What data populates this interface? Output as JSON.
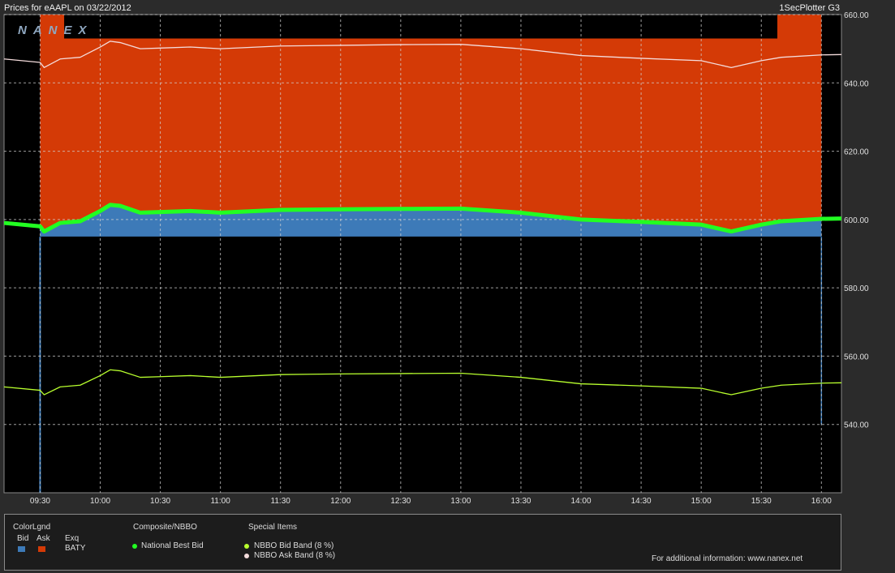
{
  "header": {
    "title": "Prices for  eAAPL  on  03/22/2012",
    "product": "1SecPlotter G3",
    "watermark": "NANEX"
  },
  "colors": {
    "bid": "#3d7ab8",
    "ask": "#d43a06",
    "nbb": "#22ff22",
    "bid_band": "#b8ff2e",
    "ask_band": "#f4dcdc"
  },
  "chart_data": {
    "type": "line",
    "title": "Prices for  eAAPL  on  03/22/2012",
    "xlabel": "",
    "ylabel": "",
    "x_ticks": [
      "09:30",
      "10:00",
      "10:30",
      "11:00",
      "11:30",
      "12:00",
      "12:30",
      "13:00",
      "13:30",
      "14:00",
      "14:30",
      "15:00",
      "15:30",
      "16:00"
    ],
    "y_ticks": [
      "540.00",
      "560.00",
      "580.00",
      "600.00",
      "620.00",
      "640.00",
      "660.00"
    ],
    "xlim": [
      "09:12",
      "16:10"
    ],
    "ylim": [
      520,
      660
    ],
    "grid": true,
    "series": [
      {
        "name": "National Best Bid",
        "color": "#22ff22",
        "x": [
          "09:12",
          "09:30",
          "09:32",
          "09:40",
          "09:50",
          "10:00",
          "10:05",
          "10:10",
          "10:20",
          "10:30",
          "10:45",
          "11:00",
          "11:30",
          "12:00",
          "12:30",
          "13:00",
          "13:30",
          "14:00",
          "14:30",
          "15:00",
          "15:15",
          "15:30",
          "15:40",
          "16:00",
          "16:10"
        ],
        "values": [
          599.0,
          598.0,
          596.5,
          599.0,
          599.5,
          602.5,
          604.3,
          604.0,
          602.0,
          602.2,
          602.5,
          602.0,
          602.8,
          603.0,
          603.1,
          603.2,
          602.0,
          600.0,
          599.3,
          598.5,
          596.5,
          598.5,
          599.5,
          600.2,
          600.3
        ]
      },
      {
        "name": "NBBO Bid Band (8 %)",
        "color": "#b8ff2e",
        "x": [
          "09:12",
          "09:30",
          "09:32",
          "09:40",
          "09:50",
          "10:00",
          "10:05",
          "10:10",
          "10:20",
          "10:30",
          "10:45",
          "11:00",
          "11:30",
          "12:00",
          "12:30",
          "13:00",
          "13:30",
          "14:00",
          "14:30",
          "15:00",
          "15:15",
          "15:30",
          "15:40",
          "16:00",
          "16:10"
        ],
        "values": [
          551.0,
          550.0,
          548.7,
          551.0,
          551.5,
          554.3,
          556.0,
          555.7,
          553.8,
          554.0,
          554.3,
          553.8,
          554.6,
          554.8,
          554.9,
          555.0,
          553.8,
          551.9,
          551.3,
          550.6,
          548.7,
          550.6,
          551.5,
          552.1,
          552.2
        ]
      },
      {
        "name": "NBBO Ask Band (8 %)",
        "color": "#f4dcdc",
        "x": [
          "09:12",
          "09:30",
          "09:32",
          "09:40",
          "09:50",
          "10:00",
          "10:05",
          "10:10",
          "10:20",
          "10:30",
          "10:45",
          "11:00",
          "11:30",
          "12:00",
          "12:30",
          "13:00",
          "13:30",
          "14:00",
          "14:30",
          "15:00",
          "15:15",
          "15:30",
          "15:40",
          "16:00",
          "16:10"
        ],
        "values": [
          647.0,
          646.0,
          644.5,
          647.0,
          647.5,
          650.5,
          652.2,
          651.8,
          650.0,
          650.2,
          650.5,
          650.0,
          650.8,
          651.0,
          651.2,
          651.3,
          650.0,
          648.0,
          647.2,
          646.5,
          644.5,
          646.5,
          647.5,
          648.2,
          648.3
        ]
      }
    ],
    "exchange_quotes": {
      "exchange": "BATY",
      "bid_quote_price": 595,
      "ask_quote_price": 653,
      "bid_spike_low": 520,
      "ask_spike_high": 660,
      "start": "09:30",
      "end": "16:00"
    }
  },
  "legend": {
    "color_title": "ColorLgnd",
    "bid_label": "Bid",
    "ask_label": "Ask",
    "exq_label": "Exq",
    "exchange": "BATY",
    "composite_title": "Composite/NBBO",
    "nbb_label": "National Best Bid",
    "special_title": "Special Items",
    "bid_band_label": "NBBO Bid Band (8 %)",
    "ask_band_label": "NBBO Ask Band (8 %)",
    "info": "For additional information: www.nanex.net"
  }
}
